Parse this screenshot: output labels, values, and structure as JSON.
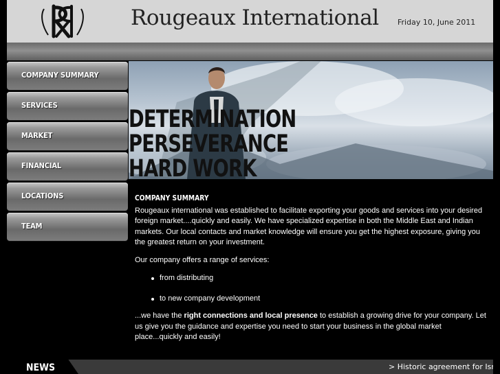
{
  "header": {
    "logo_monogram": "RR",
    "site_title": "Rougeaux International",
    "date": "Friday 10, June 2011"
  },
  "nav": {
    "items": [
      {
        "label": "COMPANY SUMMARY"
      },
      {
        "label": "SERVICES"
      },
      {
        "label": "MARKET"
      },
      {
        "label": "FINANCIAL"
      },
      {
        "label": "LOCATIONS"
      },
      {
        "label": "TEAM"
      }
    ]
  },
  "banner": {
    "lines": [
      "DETERMINATION",
      "PERSEVERANCE",
      "HARD WORK"
    ]
  },
  "content": {
    "heading": "COMPANY SUMMARY",
    "intro": "Rougeaux international was established to facilitate exporting your goods and services into your desired foreign market....quickly and easily. We have specialized expertise in both the Middle East and Indian markets. Our local contacts and market knowledge will ensure you get the highest exposure, giving you the greatest return on your investment.",
    "services_intro": "Our company offers a range of services:",
    "services": [
      "from distributing",
      "to new company development"
    ],
    "closing_prefix": "...we have the ",
    "closing_bold": "right connections and local presence",
    "closing_suffix": " to establish a growing drive for your company. Let us give you the guidance and expertise you need to start your business in the global market place...quickly and easily!"
  },
  "news": {
    "label": "NEWS",
    "ticker": "> Historic agreement for Isra"
  },
  "colors": {
    "page_background": "#000000",
    "header_background": "#d6d6d6",
    "nav_button": "#8a8a8a",
    "news_bar": "#3a3a3a"
  }
}
